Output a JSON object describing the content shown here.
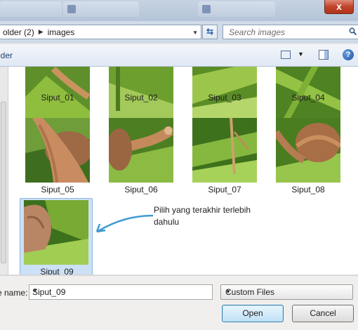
{
  "window": {
    "close_label": "x"
  },
  "address_bar": {
    "crumbs": [
      "older (2)",
      "images"
    ],
    "search_placeholder": "Search images"
  },
  "toolbar": {
    "left_label": "lder",
    "help_label": "?"
  },
  "files": [
    {
      "name": "Siput_01"
    },
    {
      "name": "Siput_02"
    },
    {
      "name": "Siput_03"
    },
    {
      "name": "Siput_04"
    },
    {
      "name": "Siput_05"
    },
    {
      "name": "Siput_06"
    },
    {
      "name": "Siput_07"
    },
    {
      "name": "Siput_08"
    },
    {
      "name": "Siput_09"
    }
  ],
  "annotation": {
    "text": "Pilih yang terakhir terlebih dahulu"
  },
  "footer": {
    "file_name_label": "e name:",
    "file_name_value": "Siput_09",
    "file_type_value": "Custom Files",
    "open_label": "Open",
    "cancel_label": "Cancel"
  }
}
